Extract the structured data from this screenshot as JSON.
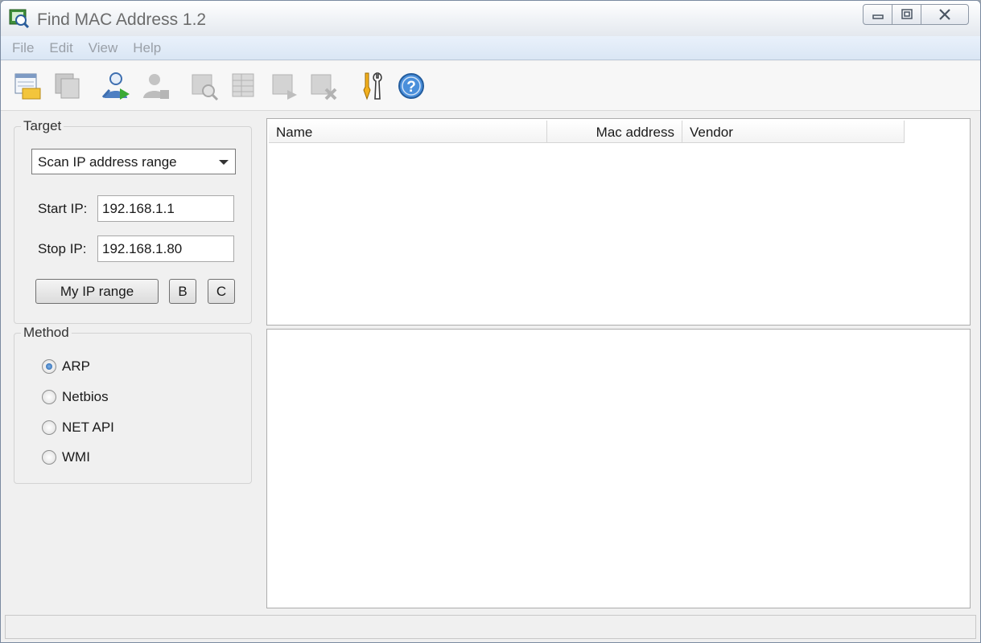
{
  "window": {
    "title": "Find MAC Address 1.2",
    "controls": {
      "minimize_icon": "minimize-icon",
      "maximize_icon": "maximize-icon",
      "close_icon": "close-icon"
    }
  },
  "menu": {
    "items": [
      {
        "label": "File"
      },
      {
        "label": "Edit"
      },
      {
        "label": "View"
      },
      {
        "label": "Help"
      }
    ]
  },
  "toolbar": {
    "buttons": [
      {
        "icon": "open-list-icon",
        "enabled": true
      },
      {
        "icon": "copy-list-icon",
        "enabled": false
      },
      {
        "icon": "start-scan-icon",
        "enabled": true
      },
      {
        "icon": "stop-scan-icon",
        "enabled": false
      },
      {
        "icon": "find-icon",
        "enabled": false
      },
      {
        "icon": "table-icon",
        "enabled": false
      },
      {
        "icon": "export-icon",
        "enabled": false
      },
      {
        "icon": "delete-icon",
        "enabled": false
      },
      {
        "icon": "settings-icon",
        "enabled": true
      },
      {
        "icon": "help-icon",
        "enabled": true
      }
    ]
  },
  "target": {
    "legend": "Target",
    "mode_selected": "Scan IP address range",
    "start_label": "Start IP:",
    "start_value": "192.168.1.1",
    "stop_label": "Stop IP:",
    "stop_value": "192.168.1.80",
    "my_range_button": "My IP range",
    "class_b_button": "B",
    "class_c_button": "C"
  },
  "method": {
    "legend": "Method",
    "options": [
      {
        "label": "ARP",
        "checked": true
      },
      {
        "label": "Netbios",
        "checked": false
      },
      {
        "label": "NET API",
        "checked": false
      },
      {
        "label": "WMI",
        "checked": false
      }
    ]
  },
  "results": {
    "columns": [
      "Name",
      "Mac address",
      "Vendor"
    ],
    "rows": []
  },
  "colors": {
    "menu_bg": "#dae6f4",
    "disabled_text": "#9aa0a8",
    "accent": "#1f5fa8"
  }
}
